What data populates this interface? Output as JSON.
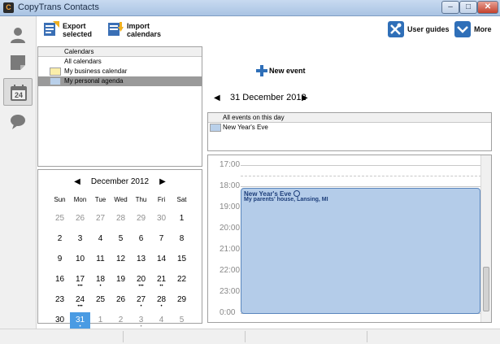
{
  "window": {
    "title": "CopyTrans Contacts",
    "controls": {
      "minimize": "–",
      "maximize": "□",
      "close": "✕"
    }
  },
  "sidebar": {
    "items": [
      {
        "name": "contacts",
        "icon": "person-icon"
      },
      {
        "name": "notes",
        "icon": "note-icon"
      },
      {
        "name": "calendar",
        "icon": "calendar-icon",
        "badge": "24",
        "active": true
      },
      {
        "name": "messages",
        "icon": "speech-bubble-icon"
      }
    ]
  },
  "toolbar": {
    "export_label": "Export\nselected",
    "import_label": "Import\ncalendars",
    "guides_label": "User guides",
    "more_label": "More"
  },
  "calendars": {
    "header": "Calendars",
    "items": [
      {
        "label": "All calendars",
        "color": ""
      },
      {
        "label": "My business calendar",
        "color": "#fbeeaa"
      },
      {
        "label": "My personal agenda",
        "color": "#b9d0ea",
        "selected": true
      }
    ]
  },
  "mini_calendar": {
    "month": "December 2012",
    "prev": "◀",
    "next": "▶",
    "weekdays": [
      "Sun",
      "Mon",
      "Tue",
      "Wed",
      "Thu",
      "Fri",
      "Sat"
    ],
    "weeks": [
      [
        {
          "d": "25",
          "o": true
        },
        {
          "d": "26",
          "o": true
        },
        {
          "d": "27",
          "o": true
        },
        {
          "d": "28",
          "o": true
        },
        {
          "d": "29",
          "o": true
        },
        {
          "d": "30",
          "o": true
        },
        {
          "d": "1"
        }
      ],
      [
        {
          "d": "2"
        },
        {
          "d": "3"
        },
        {
          "d": "4"
        },
        {
          "d": "5"
        },
        {
          "d": "6"
        },
        {
          "d": "7"
        },
        {
          "d": "8"
        }
      ],
      [
        {
          "d": "9"
        },
        {
          "d": "10"
        },
        {
          "d": "11"
        },
        {
          "d": "12"
        },
        {
          "d": "13"
        },
        {
          "d": "14"
        },
        {
          "d": "15"
        }
      ],
      [
        {
          "d": "16"
        },
        {
          "d": "17",
          "dots": "•••"
        },
        {
          "d": "18",
          "dots": "•"
        },
        {
          "d": "19"
        },
        {
          "d": "20",
          "dots": "•••"
        },
        {
          "d": "21",
          "dots": "••"
        },
        {
          "d": "22"
        }
      ],
      [
        {
          "d": "23"
        },
        {
          "d": "24",
          "dots": "•••"
        },
        {
          "d": "25"
        },
        {
          "d": "26"
        },
        {
          "d": "27",
          "dots": "•"
        },
        {
          "d": "28",
          "dots": "•"
        },
        {
          "d": "29"
        }
      ],
      [
        {
          "d": "30"
        },
        {
          "d": "31",
          "today": true,
          "dots": "•"
        },
        {
          "d": "1",
          "o": true
        },
        {
          "d": "2",
          "o": true
        },
        {
          "d": "3",
          "o": true,
          "dots": "•"
        },
        {
          "d": "4",
          "o": true
        },
        {
          "d": "5",
          "o": true
        }
      ]
    ]
  },
  "new_event_label": "New event",
  "day_view": {
    "date": "31 December 2012",
    "prev": "◀",
    "next": "▶",
    "all_day_header": "All events on this day",
    "all_day_events": [
      {
        "label": "New Year's Eve",
        "color": "#b9d0ea"
      }
    ],
    "hours": [
      "17:00",
      "18:00",
      "19:00",
      "20:00",
      "21:00",
      "22:00",
      "23:00",
      "0:00"
    ],
    "event": {
      "title": "New Year's Eve",
      "location": "My parents' house, Lansing, MI"
    }
  }
}
